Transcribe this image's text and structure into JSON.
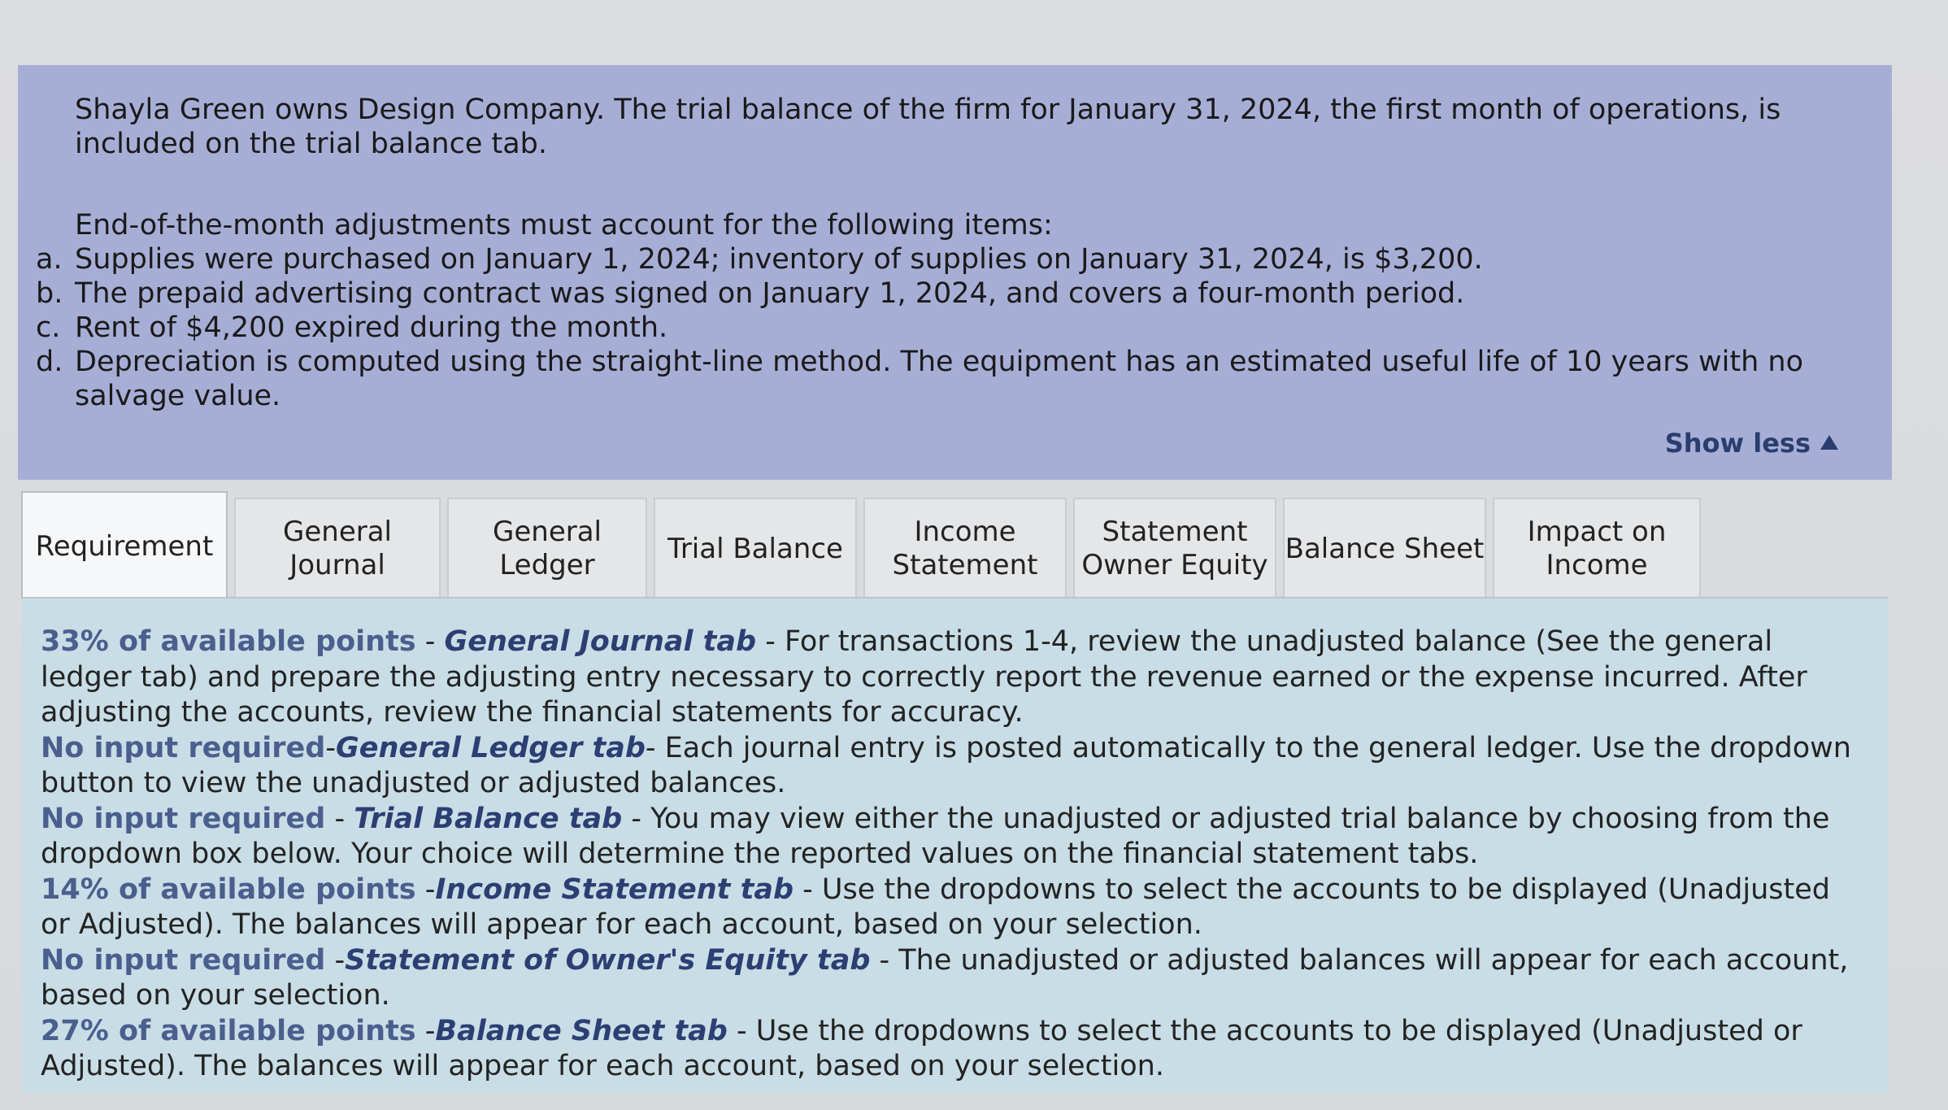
{
  "problem": {
    "intro": "Shayla Green owns Design Company. The trial balance of the firm for January 31, 2024, the first month of operations, is included on the trial balance tab.",
    "lead": "End-of-the-month adjustments must account for the following items:",
    "items": [
      {
        "mark": "a.",
        "text": "Supplies were purchased on January 1, 2024; inventory of supplies on January 31, 2024, is $3,200."
      },
      {
        "mark": "b.",
        "text": "The prepaid advertising contract was signed on January 1, 2024, and covers a four-month period."
      },
      {
        "mark": "c.",
        "text": "Rent of $4,200 expired during the month."
      },
      {
        "mark": "d.",
        "text": "Depreciation is computed using the straight-line method. The equipment has an estimated useful life of 10 years with no salvage value."
      }
    ],
    "show_less": "Show less"
  },
  "tabs": [
    {
      "line1": "Requirement",
      "line2": ""
    },
    {
      "line1": "General",
      "line2": "Journal"
    },
    {
      "line1": "General",
      "line2": "Ledger"
    },
    {
      "line1": "Trial Balance",
      "line2": ""
    },
    {
      "line1": "Income",
      "line2": "Statement"
    },
    {
      "line1": "Statement",
      "line2": "Owner Equity"
    },
    {
      "line1": "Balance Sheet",
      "line2": ""
    },
    {
      "line1": "Impact on",
      "line2": "Income"
    }
  ],
  "requirement": {
    "p1": {
      "pts": "33% of available points",
      "sep": " - ",
      "tab": "General Journal tab",
      "text": " - For transactions 1-4, review the unadjusted balance (See the general ledger tab) and prepare the adjusting entry necessary to correctly report the revenue earned or the expense incurred.  After adjusting the accounts, review the financial statements for accuracy."
    },
    "p2": {
      "pts": "No input required",
      "sep": "-",
      "tab": "General Ledger tab",
      "text": "- Each journal entry is posted automatically to the general ledger. Use the dropdown button to view the unadjusted or adjusted balances."
    },
    "p3": {
      "pts": "No input required",
      "sep": " - ",
      "tab": "Trial Balance tab",
      "text": " - You may view either the unadjusted or adjusted trial balance by choosing from the dropdown box below.  Your choice will determine the reported values on the financial statement tabs."
    },
    "p4": {
      "pts": "14% of available points",
      "sep": " -",
      "tab": "Income Statement tab",
      "text": " - Use the dropdowns to select the accounts to be displayed (Unadjusted or Adjusted).  The balances will appear for each account, based on your selection."
    },
    "p5": {
      "pts": "No input required",
      "sep": " -",
      "tab": "Statement of Owner's Equity tab",
      "text": " - The unadjusted or adjusted balances will appear for each account, based on your selection."
    },
    "p6": {
      "pts": "27% of available points",
      "sep": " -",
      "tab": "Balance Sheet tab",
      "text": " - Use the dropdowns to select the accounts to be displayed (Unadjusted or Adjusted).  The balances will appear for each account, based on your selection."
    }
  }
}
